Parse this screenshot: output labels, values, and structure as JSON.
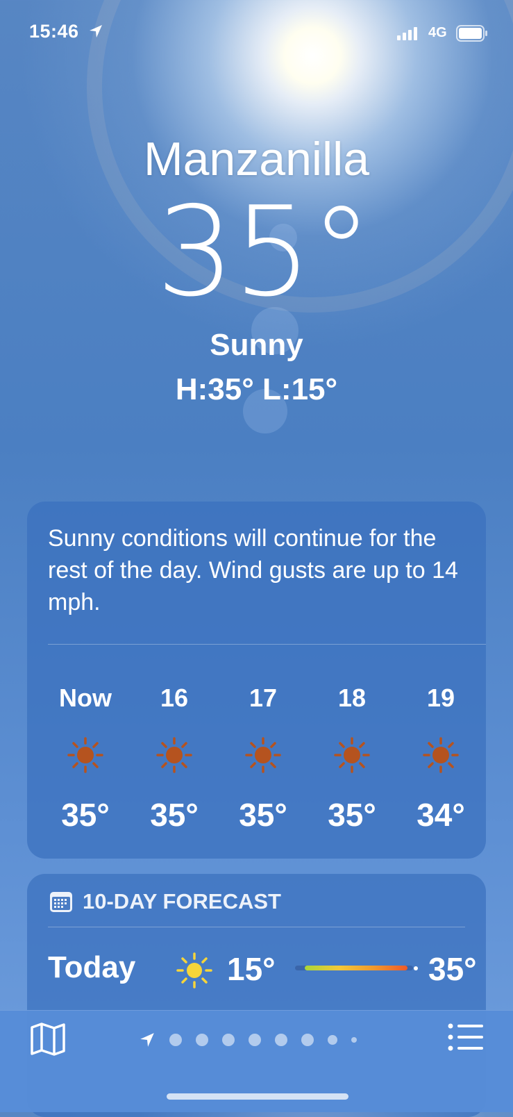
{
  "status_bar": {
    "time": "15:46",
    "network": "4G"
  },
  "location": {
    "city": "Manzanilla",
    "temperature": "35°",
    "condition": "Sunny",
    "hi_lo": "H:35°  L:15°"
  },
  "hourly": {
    "summary": "Sunny conditions will continue for the rest of the day. Wind gusts are up to 14 mph.",
    "hours": [
      {
        "label": "Now",
        "icon": "sun-icon",
        "temp": "35°"
      },
      {
        "label": "16",
        "icon": "sun-icon",
        "temp": "35°"
      },
      {
        "label": "17",
        "icon": "sun-icon",
        "temp": "35°"
      },
      {
        "label": "18",
        "icon": "sun-icon",
        "temp": "35°"
      },
      {
        "label": "19",
        "icon": "sun-icon",
        "temp": "34°"
      }
    ]
  },
  "forecast": {
    "title": "10-DAY FORECAST",
    "days": [
      {
        "day": "Today",
        "icon": "sun-icon",
        "low": "15°",
        "high": "35°"
      }
    ]
  },
  "colors": {
    "accent_sun_hourly": "#b5531f",
    "accent_sun_daily": "#f6d53a"
  },
  "tab_bar": {
    "page_dots": 8
  }
}
